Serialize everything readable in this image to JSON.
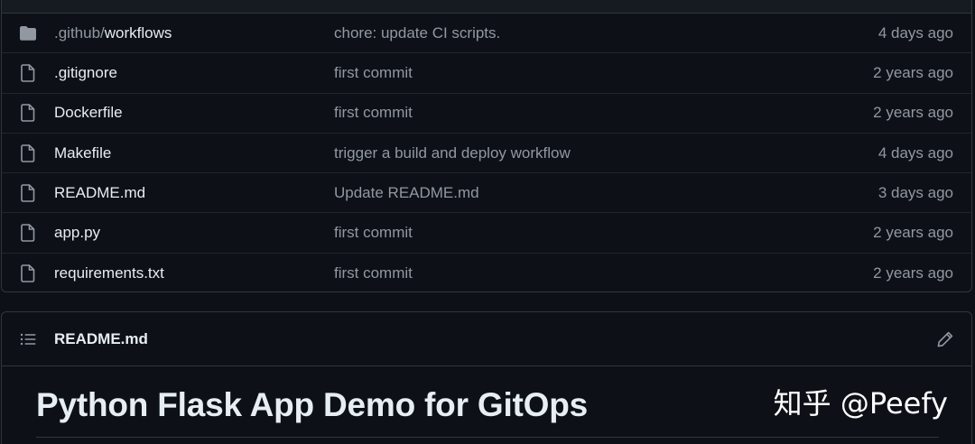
{
  "files": [
    {
      "prefix": ".github/",
      "name": "workflows",
      "type": "folder",
      "commit": "chore: update CI scripts.",
      "age": "4 days ago"
    },
    {
      "prefix": "",
      "name": ".gitignore",
      "type": "file",
      "commit": "first commit",
      "age": "2 years ago"
    },
    {
      "prefix": "",
      "name": "Dockerfile",
      "type": "file",
      "commit": "first commit",
      "age": "2 years ago"
    },
    {
      "prefix": "",
      "name": "Makefile",
      "type": "file",
      "commit": "trigger a build and deploy workflow",
      "age": "4 days ago"
    },
    {
      "prefix": "",
      "name": "README.md",
      "type": "file",
      "commit": "Update README.md",
      "age": "3 days ago"
    },
    {
      "prefix": "",
      "name": "app.py",
      "type": "file",
      "commit": "first commit",
      "age": "2 years ago"
    },
    {
      "prefix": "",
      "name": "requirements.txt",
      "type": "file",
      "commit": "first commit",
      "age": "2 years ago"
    }
  ],
  "readme": {
    "filename": "README.md",
    "heading": "Python Flask App Demo for GitOps"
  },
  "watermark": "知乎 @Peefy",
  "colors": {
    "background": "#0d1117",
    "border": "#30363d",
    "text_primary": "#e6edf3",
    "text_muted": "#9198a1",
    "folder_icon": "#9198a1"
  }
}
